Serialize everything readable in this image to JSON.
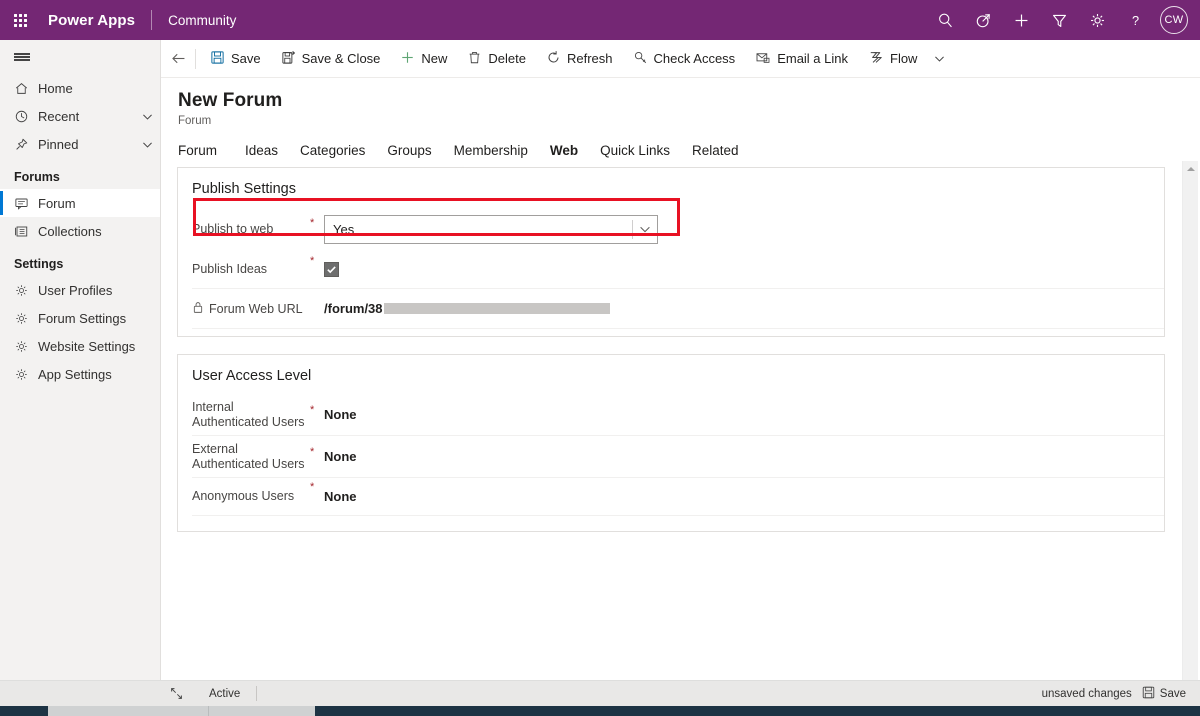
{
  "topbar": {
    "waffle_label": "waffle",
    "app_name": "Power Apps",
    "environment": "Community",
    "icons": [
      {
        "name": "search-icon",
        "label": "Search"
      },
      {
        "name": "diagnostics-icon",
        "label": "Diagnostics"
      },
      {
        "name": "plus-icon",
        "label": "New"
      },
      {
        "name": "filter-icon",
        "label": "Filter"
      },
      {
        "name": "gear-icon",
        "label": "Settings"
      },
      {
        "name": "help-icon",
        "label": "Help"
      }
    ],
    "avatar_initials": "CW"
  },
  "sidebar": {
    "hamburger_label": "Site map",
    "items": [
      {
        "label": "Home",
        "icon": "home-icon",
        "chevron": false
      },
      {
        "label": "Recent",
        "icon": "clock-icon",
        "chevron": true
      },
      {
        "label": "Pinned",
        "icon": "pin-icon",
        "chevron": true
      }
    ],
    "groups": [
      {
        "title": "Forums",
        "items": [
          {
            "label": "Forum",
            "icon": "forum-icon",
            "selected": true
          },
          {
            "label": "Collections",
            "icon": "collections-icon",
            "selected": false
          }
        ]
      },
      {
        "title": "Settings",
        "items": [
          {
            "label": "User Profiles",
            "icon": "gear-icon",
            "selected": false
          },
          {
            "label": "Forum Settings",
            "icon": "gear-icon",
            "selected": false
          },
          {
            "label": "Website Settings",
            "icon": "gear-icon",
            "selected": false
          },
          {
            "label": "App Settings",
            "icon": "gear-icon",
            "selected": false
          }
        ]
      }
    ]
  },
  "commandbar": {
    "back_label": "Back",
    "buttons": [
      {
        "label": "Save",
        "icon": "save-icon"
      },
      {
        "label": "Save & Close",
        "icon": "save-close-icon"
      },
      {
        "label": "New",
        "icon": "plus-icon"
      },
      {
        "label": "Delete",
        "icon": "trash-icon"
      },
      {
        "label": "Refresh",
        "icon": "refresh-icon"
      },
      {
        "label": "Check Access",
        "icon": "key-icon"
      },
      {
        "label": "Email a Link",
        "icon": "email-icon"
      },
      {
        "label": "Flow",
        "icon": "flow-icon"
      }
    ],
    "overflow_label": "More commands"
  },
  "record": {
    "title": "New Forum",
    "subtitle": "Forum",
    "tabs": [
      {
        "label": "Forum",
        "active": false
      },
      {
        "label": "Ideas",
        "active": false
      },
      {
        "label": "Categories",
        "active": false
      },
      {
        "label": "Groups",
        "active": false
      },
      {
        "label": "Membership",
        "active": false
      },
      {
        "label": "Web",
        "active": true
      },
      {
        "label": "Quick Links",
        "active": false
      },
      {
        "label": "Related",
        "active": false
      }
    ]
  },
  "publish_settings": {
    "title": "Publish Settings",
    "publish_to_web": {
      "label": "Publish to web",
      "required_marker": "*",
      "value": "Yes",
      "chevron_icon": "chevron-down-icon",
      "highlighted": true
    },
    "publish_ideas": {
      "label": "Publish Ideas",
      "required_marker": "*",
      "checked": true,
      "check_glyph": "✔"
    },
    "forum_web_url": {
      "label": "Forum Web URL",
      "lock_icon": "lock-icon",
      "value_prefix": "/forum/38",
      "value_redacted": true
    }
  },
  "user_access_level": {
    "title": "User Access Level",
    "rows": [
      {
        "label": "Internal Authenticated Users",
        "required_marker": "*",
        "value": "None"
      },
      {
        "label": "External Authenticated Users",
        "required_marker": "*",
        "value": "None"
      },
      {
        "label": "Anonymous Users",
        "required_marker": "*",
        "value": "None"
      }
    ]
  },
  "statusbar": {
    "expand_icon": "expand-icon",
    "state": "Active",
    "unsaved_text": "unsaved changes",
    "save_label": "Save",
    "save_icon": "save-icon"
  },
  "colors": {
    "brand_purple": "#742774",
    "accent_blue": "#0f6cbd",
    "highlight_red": "#e81123",
    "required_red": "#a4262c"
  }
}
